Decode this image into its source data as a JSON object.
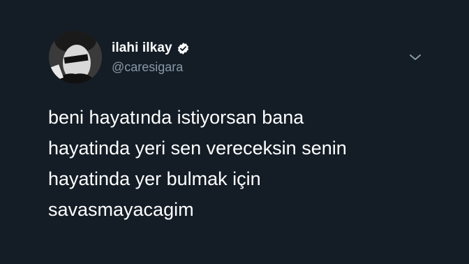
{
  "author": {
    "display_name": "ilahi ilkay",
    "handle": "@caresigara",
    "verified": true
  },
  "tweet": {
    "lines": [
      "beni hayatında istiyorsan bana",
      "hayatinda yeri sen vereceksin senin",
      "hayatinda yer bulmak için",
      "savasmayacagim"
    ]
  },
  "icons": {
    "verified": "verified-badge-icon",
    "menu": "chevron-down-icon"
  },
  "colors": {
    "background": "#141d26",
    "text": "#ffffff",
    "secondary_text": "#8899a6"
  }
}
